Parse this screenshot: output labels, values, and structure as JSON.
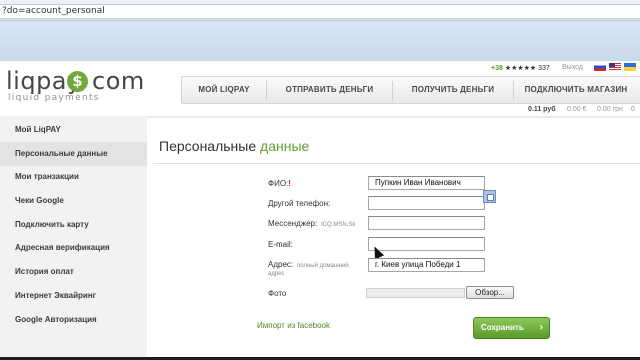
{
  "browser": {
    "address_text": "?do=account_personal"
  },
  "header": {
    "logo_left": "liqpay",
    "logo_coin": "$",
    "logo_right": "com",
    "tagline": "liquid payments",
    "phone_prefix": "+38",
    "phone_masked": "★★★★★ 337",
    "logout_label": "Выход",
    "languages": [
      "ru",
      "en",
      "ua"
    ],
    "nav": [
      {
        "label": "МОЙ LIQPAY"
      },
      {
        "label": "ОТПРАВИТЬ ДЕНЬГИ"
      },
      {
        "label": "ПОЛУЧИТЬ ДЕНЬГИ"
      },
      {
        "label": "ПОДКЛЮЧИТЬ МАГАЗИН"
      }
    ],
    "balances": {
      "rub": "0.11 руб",
      "eur": "0.00 €",
      "uah": "0.00 грн",
      "fourth": "0"
    }
  },
  "sidebar": {
    "items": [
      {
        "label": "Мой LiqPAY"
      },
      {
        "label": "Персональные данные"
      },
      {
        "label": "Мои транзакции"
      },
      {
        "label": "Чеки Google"
      },
      {
        "label": "Подключить карту"
      },
      {
        "label": "Адресная верификация"
      },
      {
        "label": "История оплат"
      },
      {
        "label": "Интернет Эквайринг"
      },
      {
        "label": "Google Авторизация"
      }
    ],
    "active_index": 1
  },
  "main": {
    "title_plain": "Персональные",
    "title_accent": "данные",
    "form": {
      "fio_label": "ФИО:",
      "fio_required_mark": "!",
      "fio_value": "Пупкин Иван Иванович",
      "phone_label": "Другой телефон:",
      "phone_value": "",
      "messenger_label": "Мессенджер:",
      "messenger_hint": "ICQ,MSN,Sk",
      "messenger_value": "",
      "email_label": "E-mail:",
      "email_value": "",
      "address_label": "Адрес:",
      "address_hint_line1": "полный домашний",
      "address_hint_line2": "адрес",
      "address_value": "г. Киев улица Победи 1",
      "photo_label": "Фото",
      "browse_label": "Обзор..."
    },
    "facebook_import": "Импорт из facebook",
    "save_label": "Сохранить",
    "save_arrow": "›"
  },
  "colors": {
    "brand_green": "#5e9f2e",
    "required_red": "#d22233"
  }
}
